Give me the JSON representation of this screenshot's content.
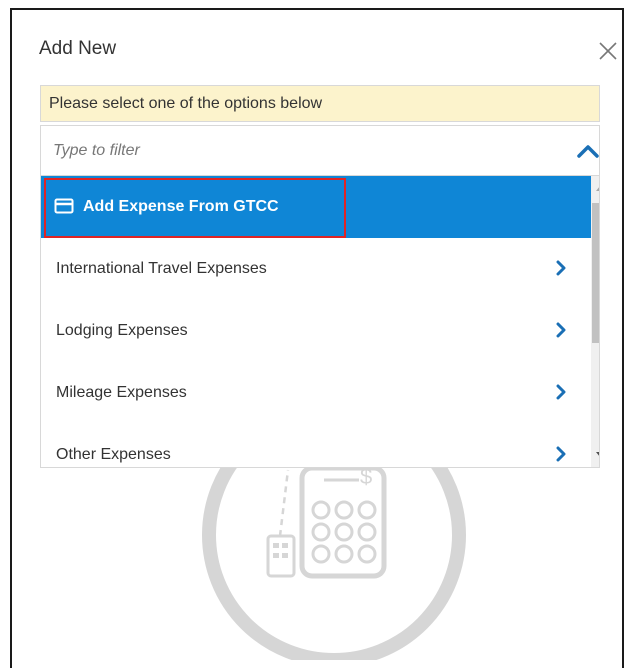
{
  "dialog": {
    "title": "Add New",
    "close_icon": "close-icon",
    "notice": "Please select one of the options below",
    "filter": {
      "placeholder": "Type to filter",
      "value": ""
    },
    "collapse_icon": "chevron-up-icon",
    "options": [
      {
        "label": "Add Expense From GTCC",
        "icon": "credit-card-icon",
        "selected": true
      },
      {
        "label": "International Travel Expenses",
        "icon": "chevron-right-icon"
      },
      {
        "label": "Lodging Expenses",
        "icon": "chevron-right-icon"
      },
      {
        "label": "Mileage Expenses",
        "icon": "chevron-right-icon"
      },
      {
        "label": "Other Expenses",
        "icon": "chevron-right-icon"
      }
    ],
    "background_icon": "calculator-receipt-icon"
  },
  "colors": {
    "accent": "#0f86d6",
    "notice_bg": "#fcf3cc",
    "highlight": "#e02424",
    "chevron": "#1a6fb5"
  }
}
